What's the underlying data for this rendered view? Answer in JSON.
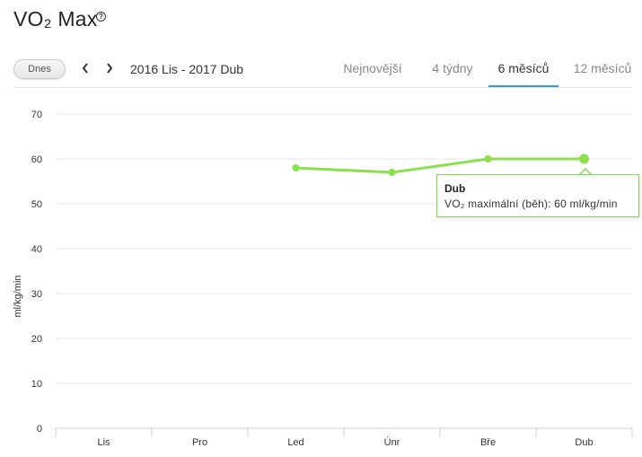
{
  "header": {
    "title": "VO₂ Max",
    "help_icon": "question-circle-icon"
  },
  "toolbar": {
    "today_label": "Dnes",
    "prev_icon": "chevron-left-icon",
    "next_icon": "chevron-right-icon",
    "date_range": "2016 Lis - 2017 Dub"
  },
  "tabs": [
    {
      "label": "Nejnovější",
      "active": false
    },
    {
      "label": "4 týdny",
      "active": false
    },
    {
      "label": "6 měsíců",
      "active": true
    },
    {
      "label": "12 měsíců",
      "active": false
    }
  ],
  "colors": {
    "series": "#8be04e",
    "tab_active": "#2a9fd6",
    "grid": "#e5e5e5"
  },
  "tooltip": {
    "title": "Dub",
    "text": "VO₂ maximální (běh): 60 ml/kg/min"
  },
  "chart_data": {
    "type": "line",
    "categories": [
      "Lis",
      "Pro",
      "Led",
      "Únr",
      "Bře",
      "Dub"
    ],
    "series": [
      {
        "values": [
          null,
          null,
          58,
          57,
          60,
          60
        ]
      }
    ],
    "ylabel": "ml/kg/min",
    "ylim": [
      0,
      70
    ],
    "yticks": [
      0,
      10,
      20,
      30,
      40,
      50,
      60,
      70
    ],
    "grid": true,
    "highlighted_category": "Dub"
  }
}
